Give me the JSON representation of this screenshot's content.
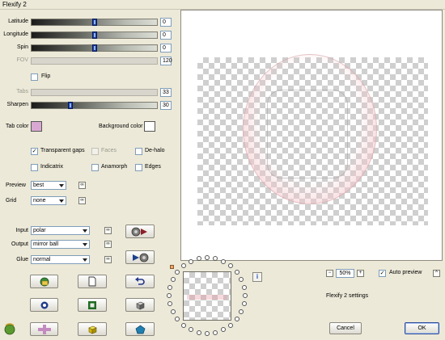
{
  "window": {
    "title": "Flexify 2"
  },
  "sliders": [
    {
      "label": "Latitude",
      "value": "0",
      "disabled": false,
      "level": 0.5
    },
    {
      "label": "Longitude",
      "value": "0",
      "disabled": false,
      "level": 0.5
    },
    {
      "label": "Spin",
      "value": "0",
      "disabled": false,
      "level": 0.5
    },
    {
      "label": "FOV",
      "value": "120",
      "disabled": true,
      "level": 0
    },
    {
      "label": "Tabs",
      "value": "33",
      "disabled": true,
      "level": 0
    },
    {
      "label": "Sharpen",
      "value": "30",
      "disabled": false,
      "level": 0.3
    }
  ],
  "flip": {
    "label": "Flip",
    "checked": false
  },
  "colors": {
    "tab_color_label": "Tab color",
    "tab_color": "#d9a8d2",
    "background_color_label": "Background color",
    "background_color": "#ffffff"
  },
  "options": {
    "transparent_gaps": {
      "label": "Transparent gaps",
      "checked": true
    },
    "faces": {
      "label": "Faces",
      "checked": false
    },
    "de_halo": {
      "label": "De-halo",
      "checked": false
    },
    "indicatrix": {
      "label": "Indicatrix",
      "checked": false
    },
    "anamorph": {
      "label": "Anamorph",
      "checked": false
    },
    "edges": {
      "label": "Edges",
      "checked": false
    }
  },
  "preview_select": {
    "label": "Preview",
    "value": "best"
  },
  "grid_select": {
    "label": "Grid",
    "value": "none"
  },
  "input_select": {
    "label": "Input",
    "value": "polar"
  },
  "output_select": {
    "label": "Output",
    "value": "mirror ball"
  },
  "glue_select": {
    "label": "Glue",
    "value": "normal"
  },
  "zoom": {
    "minus": "−",
    "value": "50%",
    "plus": "+"
  },
  "auto_preview": {
    "label": "Auto preview",
    "checked": true
  },
  "settings_label": "Flexify 2 settings",
  "buttons": {
    "cancel": "Cancel",
    "ok": "OK"
  },
  "icons": {
    "info": "i",
    "link": "∞",
    "collapse": "^"
  }
}
